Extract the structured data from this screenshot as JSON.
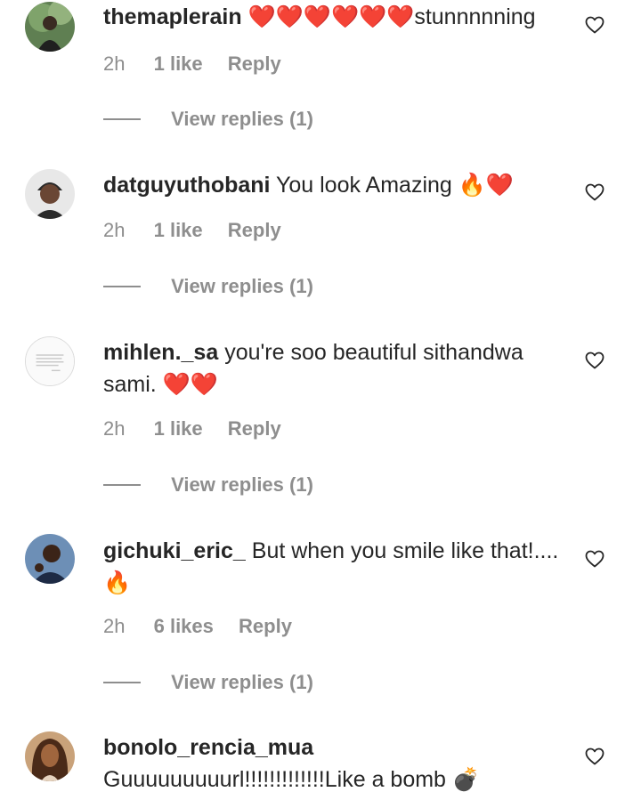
{
  "comments": [
    {
      "username": "themaplerain",
      "text": "❤️❤️❤️❤️❤️❤️stunnnnning",
      "time": "2h",
      "likes": "1 like",
      "reply": "Reply",
      "view_replies": "View replies (1)"
    },
    {
      "username": "datguyuthobani",
      "text": "You look Amazing 🔥❤️",
      "time": "2h",
      "likes": "1 like",
      "reply": "Reply",
      "view_replies": "View replies (1)"
    },
    {
      "username": "mihlen._sa",
      "text": "you're soo beautiful sithandwa sami. ❤️❤️",
      "time": "2h",
      "likes": "1 like",
      "reply": "Reply",
      "view_replies": "View replies (1)"
    },
    {
      "username": "gichuki_eric_",
      "text": "But when you smile like that!....🔥",
      "time": "2h",
      "likes": "6 likes",
      "reply": "Reply",
      "view_replies": "View replies (1)"
    },
    {
      "username": "bonolo_rencia_mua",
      "text": "Guuuuuuuuurl!!!!!!!!!!!!!Like a bomb 💣",
      "time": "",
      "likes": "",
      "reply": "",
      "view_replies": ""
    }
  ],
  "icons": {
    "like": "heart-outline-icon"
  },
  "colors": {
    "text": "#262626",
    "meta": "#8e8e8e",
    "heart": "#262626"
  }
}
